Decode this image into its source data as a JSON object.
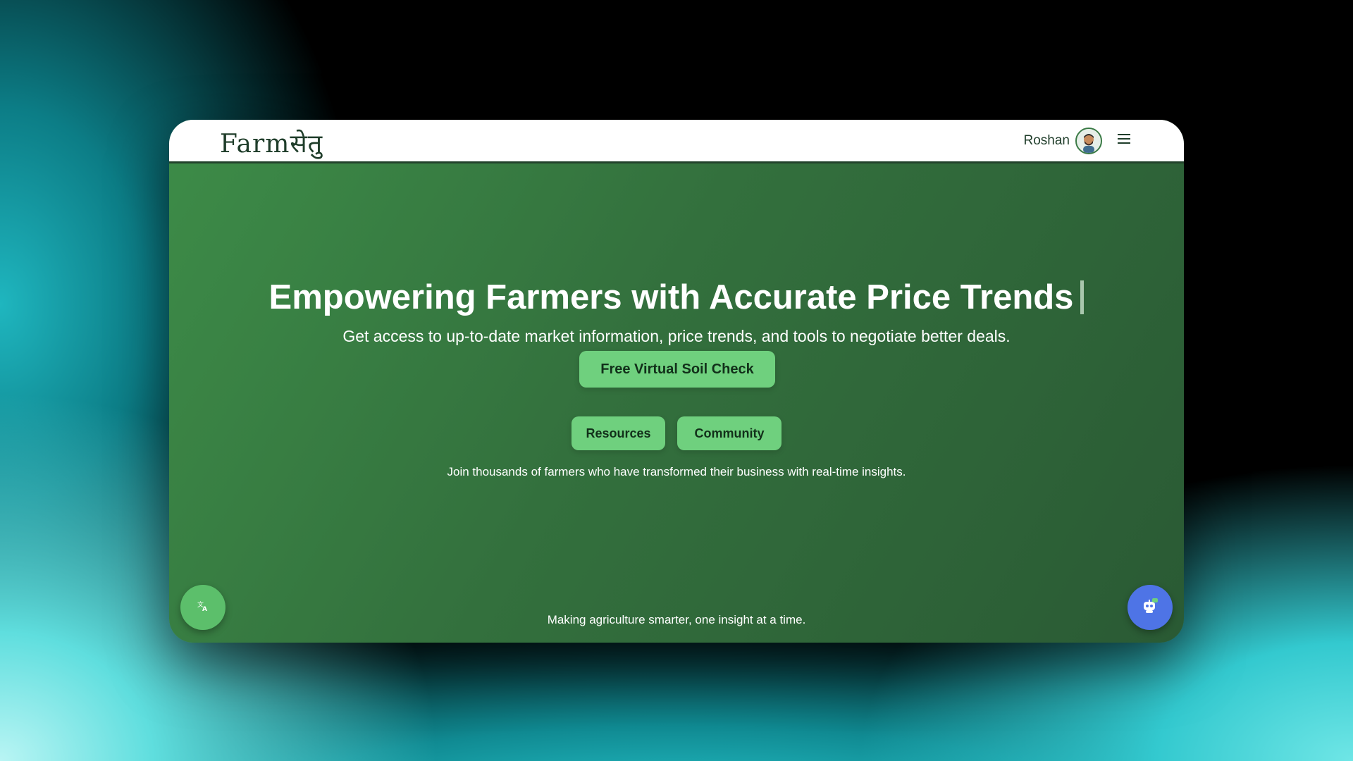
{
  "nav": {
    "logo_text": "Farmसेतु",
    "user_name": "Roshan",
    "avatar_icon": "user-avatar-icon",
    "menu_icon": "hamburger-menu-icon"
  },
  "hero": {
    "title": "Empowering Farmers with Accurate Price Trends",
    "subtitle": "Get access to up-to-date market information, price trends, and tools to negotiate better deals.",
    "primary_cta": "Free Virtual Soil Check",
    "resources_label": "Resources",
    "community_label": "Community",
    "join_text": "Join thousands of farmers who have transformed their business with real-time insights.",
    "tagline": "Making agriculture smarter, one insight at a time."
  },
  "floating": {
    "translate_icon": "translate-icon",
    "chatbot_icon": "chatbot-icon"
  },
  "colors": {
    "brand_dark": "#1f3d2a",
    "button_green": "#6fd07e",
    "translate_fab": "#5cbf6b",
    "chat_fab": "#4e74e6"
  }
}
